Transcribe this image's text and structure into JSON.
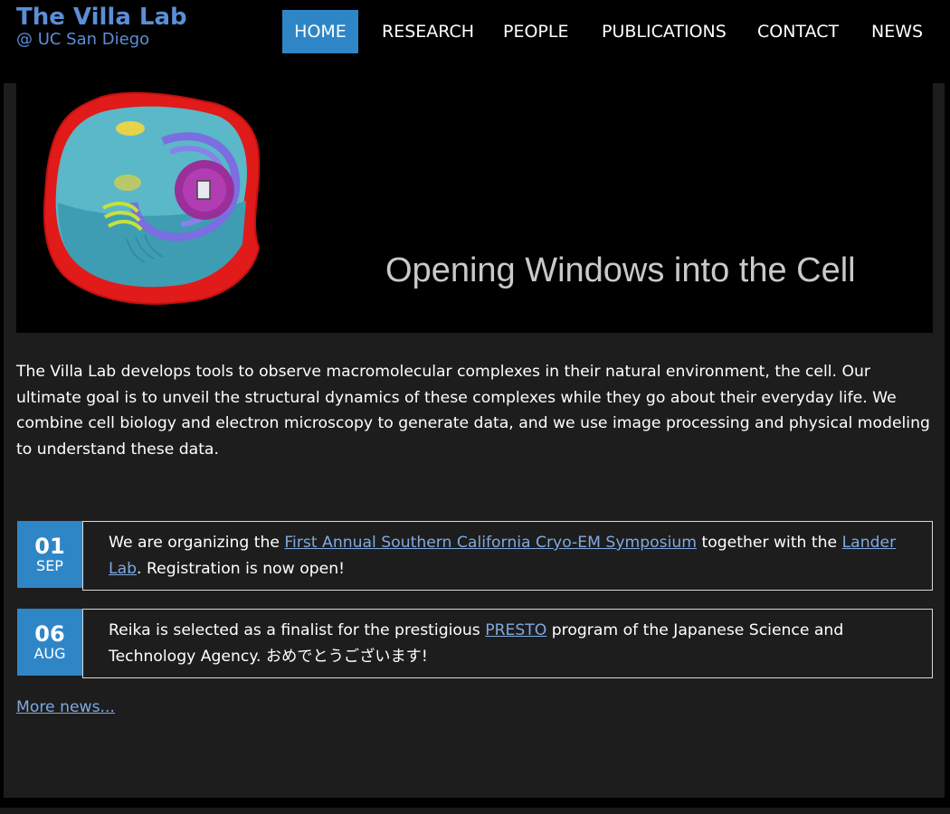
{
  "site": {
    "title": "The Villa Lab",
    "subtitle": "@ UC San Diego"
  },
  "nav": {
    "items": [
      {
        "label": "HOME",
        "active": true
      },
      {
        "label": "RESEARCH",
        "active": false
      },
      {
        "label": "PEOPLE",
        "active": false
      },
      {
        "label": "PUBLICATIONS",
        "active": false
      },
      {
        "label": "CONTACT",
        "active": false
      },
      {
        "label": "NEWS",
        "active": false
      }
    ]
  },
  "banner": {
    "tagline": "Opening Windows into the Cell",
    "image": "cell-illustration"
  },
  "intro": {
    "text": "The Villa Lab develops tools to observe macromolecular complexes in their natural environment, the cell. Our ultimate goal is to unveil the structural dynamics of these complexes while they go about their everyday life. We combine cell biology and electron microscopy to generate data, and we use image processing and physical modeling to understand these data."
  },
  "news": {
    "items": [
      {
        "day": "01",
        "month": "SEP",
        "text_before": "We are organizing the ",
        "link1": "First Annual Southern California Cryo-EM Symposium",
        "text_middle": " together with the ",
        "link2": "Lander Lab",
        "text_after": ". Registration is now open!"
      },
      {
        "day": "06",
        "month": "AUG",
        "text_before": "Reika is selected as a finalist for the prestigious ",
        "link1": "PRESTO",
        "text_after": " program of the Japanese Science and Technology Agency. おめでとうございます!"
      }
    ],
    "more_label": "More news..."
  },
  "colors": {
    "accent": "#2f86c7",
    "brand": "#5b8ed6",
    "link": "#7fa9e0",
    "background": "#1d1d1d"
  }
}
